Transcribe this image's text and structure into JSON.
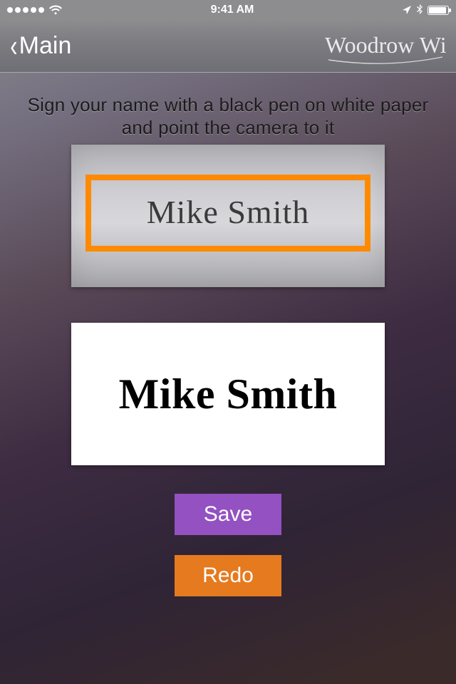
{
  "status": {
    "time": "9:41 AM"
  },
  "nav": {
    "back_label": "Main",
    "logo_text": "Woodrow Wilson"
  },
  "content": {
    "instruction": "Sign your name with a black pen on white paper and point the camera to it",
    "camera_signature": "Mike Smith",
    "processed_signature": "Mike Smith"
  },
  "buttons": {
    "save": "Save",
    "redo": "Redo"
  },
  "colors": {
    "crop_border": "#ff8a00",
    "save_bg": "#9451c1",
    "redo_bg": "#e67a1f"
  }
}
